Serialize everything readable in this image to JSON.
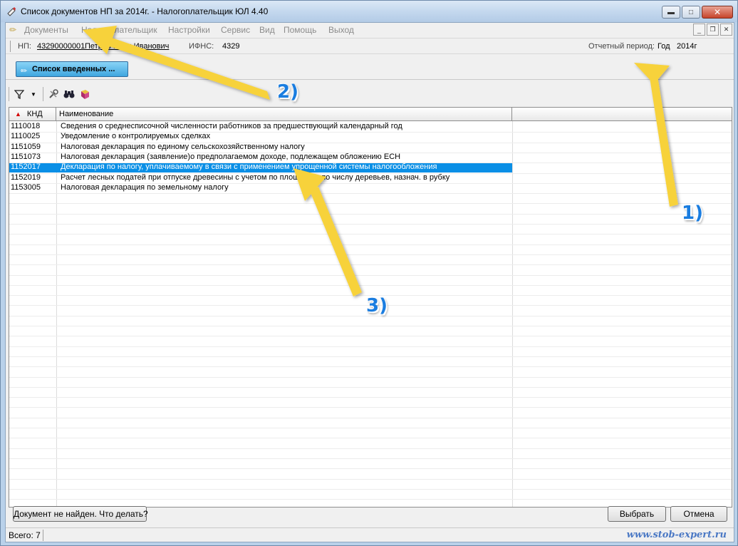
{
  "window": {
    "title": "Список документов НП за 2014г. - Налогоплательщик ЮЛ 4.40",
    "controls": [
      "minimize-icon",
      "maximize-icon",
      "close-icon"
    ]
  },
  "menu": {
    "items": [
      "Документы",
      "Налогоплательщик",
      "Настройки",
      "Сервис",
      "Вид",
      "Помощь",
      "Выход"
    ]
  },
  "info": {
    "np_label": "НП:",
    "np_value": "43290000001",
    "np_name": "Петров Иван Иванович",
    "ifns_label": "ИФНС:",
    "ifns_value": "4329",
    "period_label": "Отчетный период:",
    "period_type": "Год",
    "period_value": "2014г"
  },
  "tab": {
    "label": "Список введенных ..."
  },
  "toolbar": {
    "icons": [
      "filter-icon",
      "dropdown-arrow-icon",
      "tools-icon",
      "binoculars-icon",
      "book-icon"
    ]
  },
  "grid": {
    "columns": [
      "КНД",
      "Наименование"
    ],
    "rows": [
      {
        "knd": "1110018",
        "name": "Сведения о среднесписочной численности работников за предшествующий календарный год"
      },
      {
        "knd": "1110025",
        "name": "Уведомление о контролируемых сделках"
      },
      {
        "knd": "1151059",
        "name": "Налоговая декларация по единому сельскохозяйственному налогу"
      },
      {
        "knd": "1151073",
        "name": "Налоговая декларация (заявление)о предполагаемом доходе, подлежащем обложению ЕСН"
      },
      {
        "knd": "1152017",
        "name": "Декларация по налогу, уплачиваемому в связи с применением упрощенной системы налогообложения"
      },
      {
        "knd": "1152019",
        "name": "Расчет лесных податей при отпуске древесины с учетом по площади и по числу деревьев, назнач. в рубку"
      },
      {
        "knd": "1153005",
        "name": "Налоговая декларация по земельному налогу"
      }
    ],
    "selected_index": 4
  },
  "buttons": {
    "not_found": "Документ не найден. Что делать?",
    "select": "Выбрать",
    "cancel": "Отмена"
  },
  "status": {
    "total": "Всего: 7",
    "watermark": "www.stob-expert.ru"
  },
  "annotations": [
    "1)",
    "2)",
    "3)"
  ],
  "colors": {
    "selection": "#0a8fe6",
    "arrow": "#f7d23a",
    "annotation_text": "#1a7de0"
  }
}
